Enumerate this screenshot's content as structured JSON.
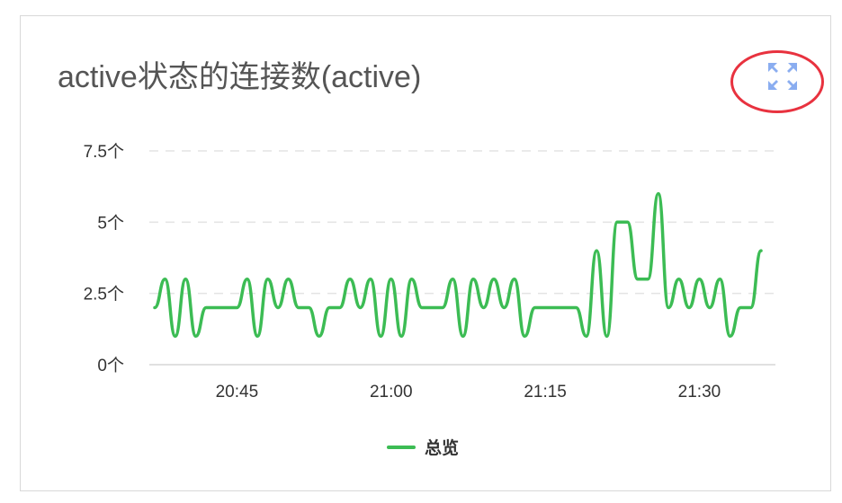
{
  "title": "active状态的连接数(active)",
  "expand_icon": "expand-arrows-icon",
  "colors": {
    "series": "#3cbc54",
    "grid": "#e4e4e4",
    "axis_text": "#333333",
    "highlight": "#e8323f",
    "icon": "#8aadf0"
  },
  "chart_data": {
    "type": "line",
    "title": "active状态的连接数(active)",
    "ylim": [
      0,
      7.5
    ],
    "yticks": [
      "0个",
      "2.5个",
      "5个",
      "7.5个"
    ],
    "ytick_values": [
      0,
      2.5,
      5,
      7.5
    ],
    "xticks": [
      "20:45",
      "21:00",
      "21:15",
      "21:30"
    ],
    "xtick_values": [
      "20:45",
      "21:00",
      "21:15",
      "21:30"
    ],
    "grid": true,
    "legend": "bottom-center",
    "series": [
      {
        "name": "总览",
        "x": [
          "20:37",
          "20:38",
          "20:39",
          "20:40",
          "20:41",
          "20:42",
          "20:43",
          "20:44",
          "20:45",
          "20:46",
          "20:47",
          "20:48",
          "20:49",
          "20:50",
          "20:51",
          "20:52",
          "20:53",
          "20:54",
          "20:55",
          "20:56",
          "20:57",
          "20:58",
          "20:59",
          "21:00",
          "21:01",
          "21:02",
          "21:03",
          "21:04",
          "21:05",
          "21:06",
          "21:07",
          "21:08",
          "21:09",
          "21:10",
          "21:11",
          "21:12",
          "21:13",
          "21:14",
          "21:15",
          "21:16",
          "21:17",
          "21:18",
          "21:19",
          "21:20",
          "21:21",
          "21:22",
          "21:23",
          "21:24",
          "21:25",
          "21:26",
          "21:27",
          "21:28",
          "21:29",
          "21:30",
          "21:31",
          "21:32",
          "21:33",
          "21:34",
          "21:35",
          "21:36"
        ],
        "values": [
          2,
          3,
          1,
          3,
          1,
          2,
          2,
          2,
          2,
          3,
          1,
          3,
          2,
          3,
          2,
          2,
          1,
          2,
          2,
          3,
          2,
          3,
          1,
          3,
          1,
          3,
          2,
          2,
          2,
          3,
          1,
          3,
          2,
          3,
          2,
          3,
          1,
          2,
          2,
          2,
          2,
          2,
          1,
          4,
          1,
          5,
          5,
          3,
          3,
          6,
          2,
          3,
          2,
          3,
          2,
          3,
          1,
          2,
          2,
          4
        ]
      }
    ]
  }
}
